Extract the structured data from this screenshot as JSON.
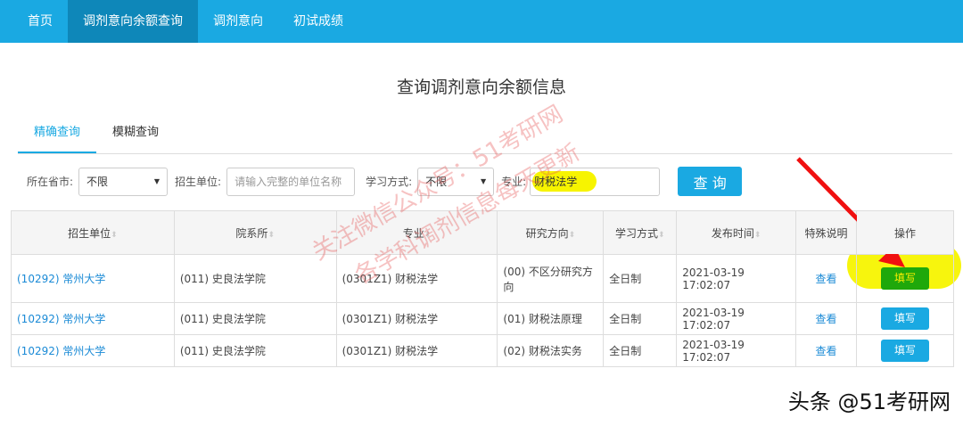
{
  "nav": [
    "首页",
    "调剂意向余额查询",
    "调剂意向",
    "初试成绩"
  ],
  "title": "查询调剂意向余额信息",
  "tabs": [
    "精确查询",
    "模糊查询"
  ],
  "form": {
    "province_label": "所在省市:",
    "province_value": "不限",
    "unit_label": "招生单位:",
    "unit_placeholder": "请输入完整的单位名称",
    "mode_label": "学习方式:",
    "mode_value": "不限",
    "major_label": "专业:",
    "major_value": "财税法学",
    "search": "查 询"
  },
  "headers": [
    "招生单位",
    "院系所",
    "专业",
    "研究方向",
    "学习方式",
    "发布时间",
    "特殊说明",
    "操作"
  ],
  "rows": [
    {
      "unit": "(10292) 常州大学",
      "dept": "(011) 史良法学院",
      "major": "(0301Z1) 财税法学",
      "dir": "(00) 不区分研究方向",
      "mode": "全日制",
      "time": "2021-03-19 17:02:07",
      "note": "查看",
      "action": "填写"
    },
    {
      "unit": "(10292) 常州大学",
      "dept": "(011) 史良法学院",
      "major": "(0301Z1) 财税法学",
      "dir": "(01) 财税法原理",
      "mode": "全日制",
      "time": "2021-03-19 17:02:07",
      "note": "查看",
      "action": "填写"
    },
    {
      "unit": "(10292) 常州大学",
      "dept": "(011) 史良法学院",
      "major": "(0301Z1) 财税法学",
      "dir": "(02) 财税法实务",
      "mode": "全日制",
      "time": "2021-03-19 17:02:07",
      "note": "查看",
      "action": "填写"
    }
  ],
  "watermark": [
    "关注微信公众号：51考研网",
    "各学科调剂信息每天更新"
  ],
  "signature": "头条 @51考研网"
}
